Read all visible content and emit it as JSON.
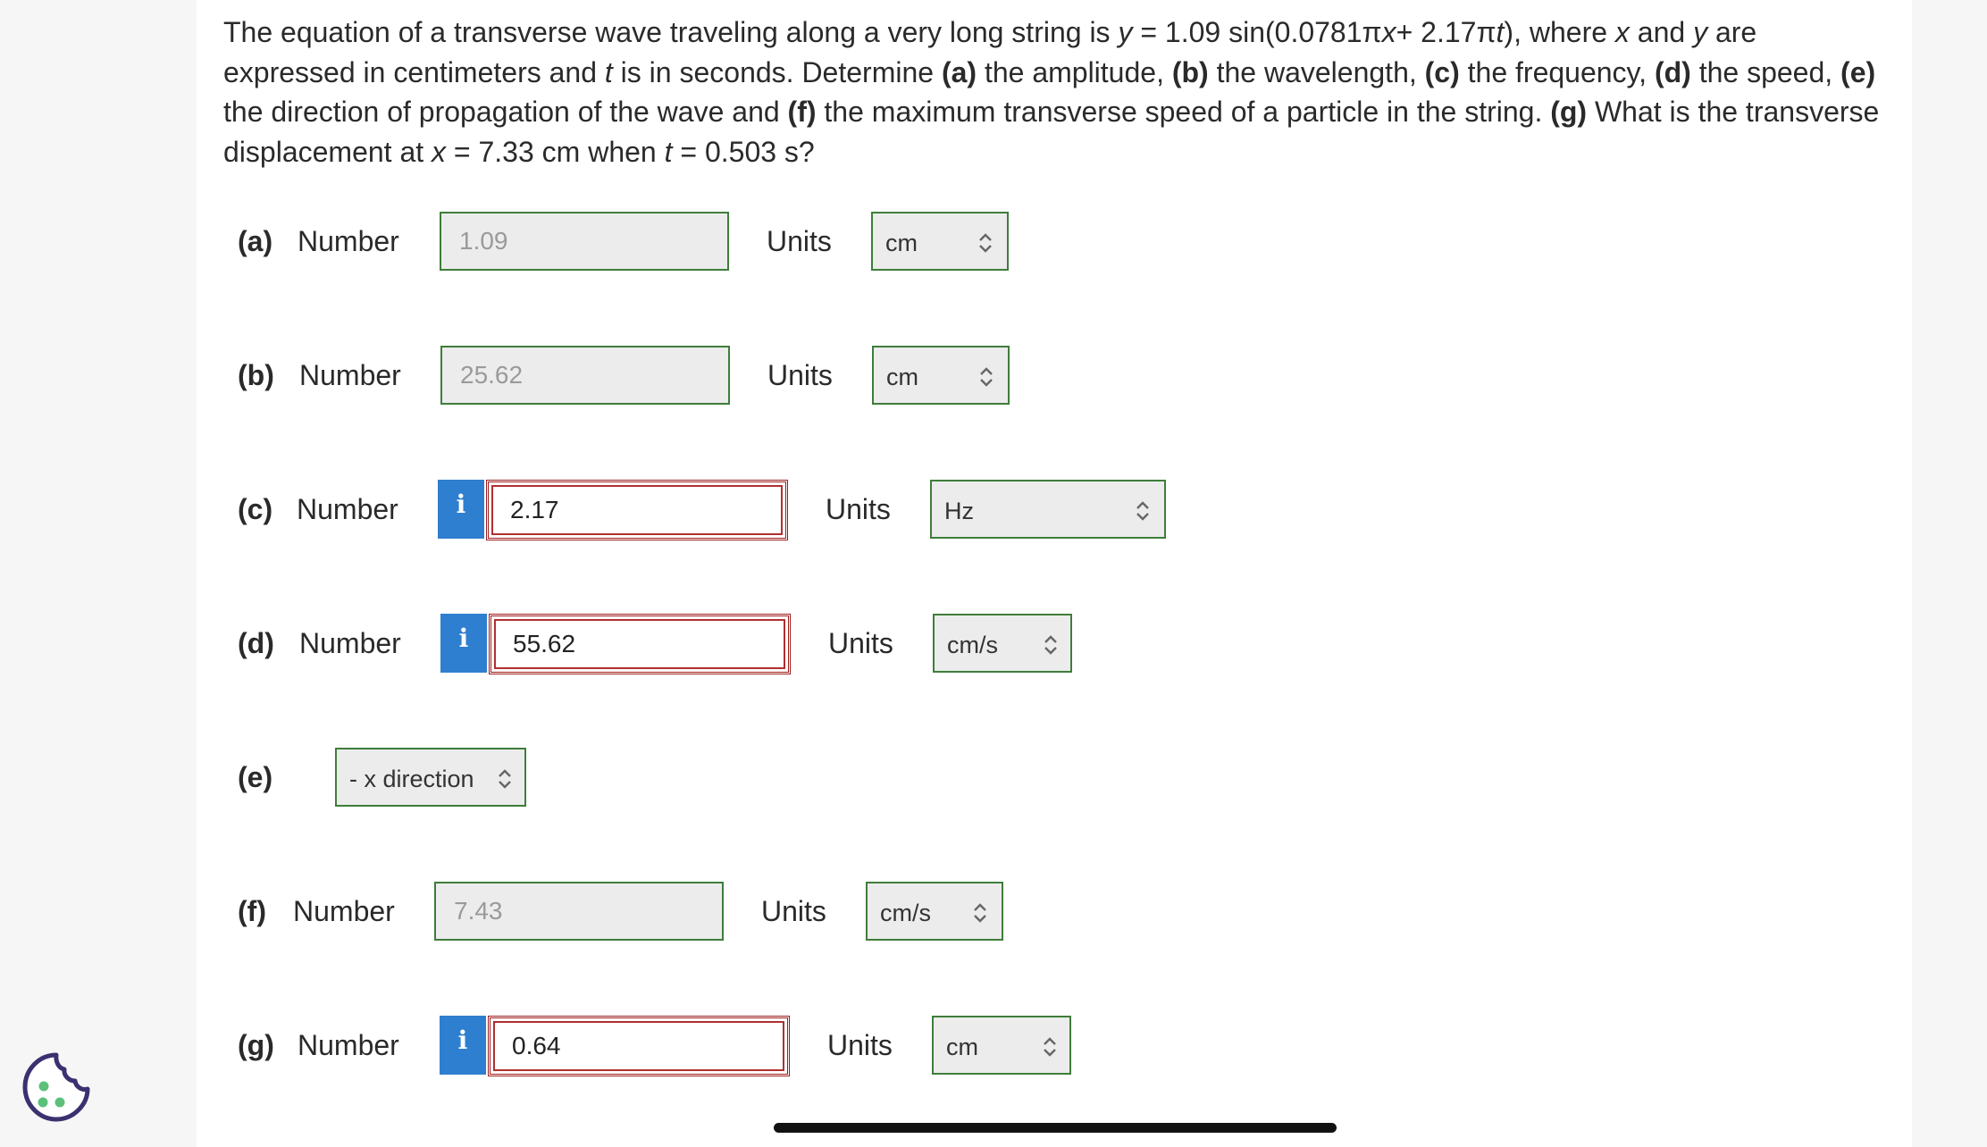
{
  "question": {
    "intro": "The equation of a transverse wave traveling along a very long string is ",
    "eq_y": "y",
    "eq_mid": " = 1.09 sin(0.0781π",
    "eq_x": "x",
    "eq_mid2": "+ 2.17π",
    "eq_t": "t",
    "eq_end": "), where ",
    "var_x": "x",
    "and": " and ",
    "var_y": "y",
    "units_text": " are expressed in centimeters and ",
    "var_t": "t",
    "seconds_text": " is in seconds. Determine ",
    "pa": "(a)",
    "ta": " the amplitude, ",
    "pb": "(b)",
    "tb": " the wavelength, ",
    "pc": "(c)",
    "tc": " the frequency, ",
    "pd": "(d)",
    "td": " the speed, ",
    "pe": "(e)",
    "te": " the direction of propagation of the wave and ",
    "pf": "(f)",
    "tf": " the maximum transverse speed of a particle in the string. ",
    "pg": "(g)",
    "tg": " What is the transverse displacement at ",
    "gx": "x",
    "tg2": " = 7.33 cm when ",
    "gt": "t",
    "tg3": " = 0.503 s?"
  },
  "parts": [
    {
      "key": "(a)",
      "label": "Number",
      "value": "1.09",
      "units_label": "Units",
      "unit": "cm",
      "status": "correct"
    },
    {
      "key": "(b)",
      "label": "Number",
      "value": "25.62",
      "units_label": "Units",
      "unit": "cm",
      "status": "correct"
    },
    {
      "key": "(c)",
      "label": "Number",
      "value": "2.17",
      "units_label": "Units",
      "unit": "Hz",
      "status": "incorrect",
      "info": "i"
    },
    {
      "key": "(d)",
      "label": "Number",
      "value": "55.62",
      "units_label": "Units",
      "unit": "cm/s",
      "status": "incorrect",
      "info": "i"
    },
    {
      "key": "(e)",
      "direction": "- x direction",
      "status": "correct"
    },
    {
      "key": "(f)",
      "label": "Number",
      "value": "7.43",
      "units_label": "Units",
      "unit": "cm/s",
      "status": "correct"
    },
    {
      "key": "(g)",
      "label": "Number",
      "value": "0.64",
      "units_label": "Units",
      "unit": "cm",
      "status": "incorrect",
      "info": "i"
    }
  ],
  "colors": {
    "correct_border": "#3f7d3a",
    "incorrect_border": "#9e1b1b",
    "info_bg": "#2f7fd0",
    "cookie": "#3b3170",
    "cookie_dots": "#5cc07a"
  },
  "icons": {
    "info": "info-icon",
    "select": "chevron-updown-icon",
    "cookie": "cookie-icon"
  }
}
